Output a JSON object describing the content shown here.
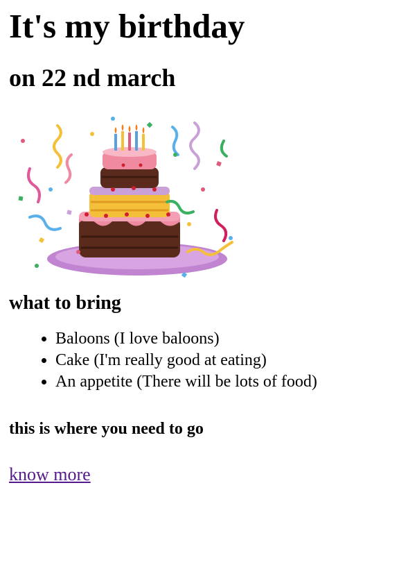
{
  "heading": "It's my birthday",
  "subheading": "on 22 nd march",
  "image": {
    "alt": "birthday cake with confetti"
  },
  "bring": {
    "title": "what to bring",
    "items": [
      "Baloons (I love baloons)",
      "Cake (I'm really good at eating)",
      "An appetite (There will be lots of food)"
    ]
  },
  "directions": {
    "title": "this is where you need to go"
  },
  "link": {
    "label": "know more",
    "color": "#551a8b"
  }
}
